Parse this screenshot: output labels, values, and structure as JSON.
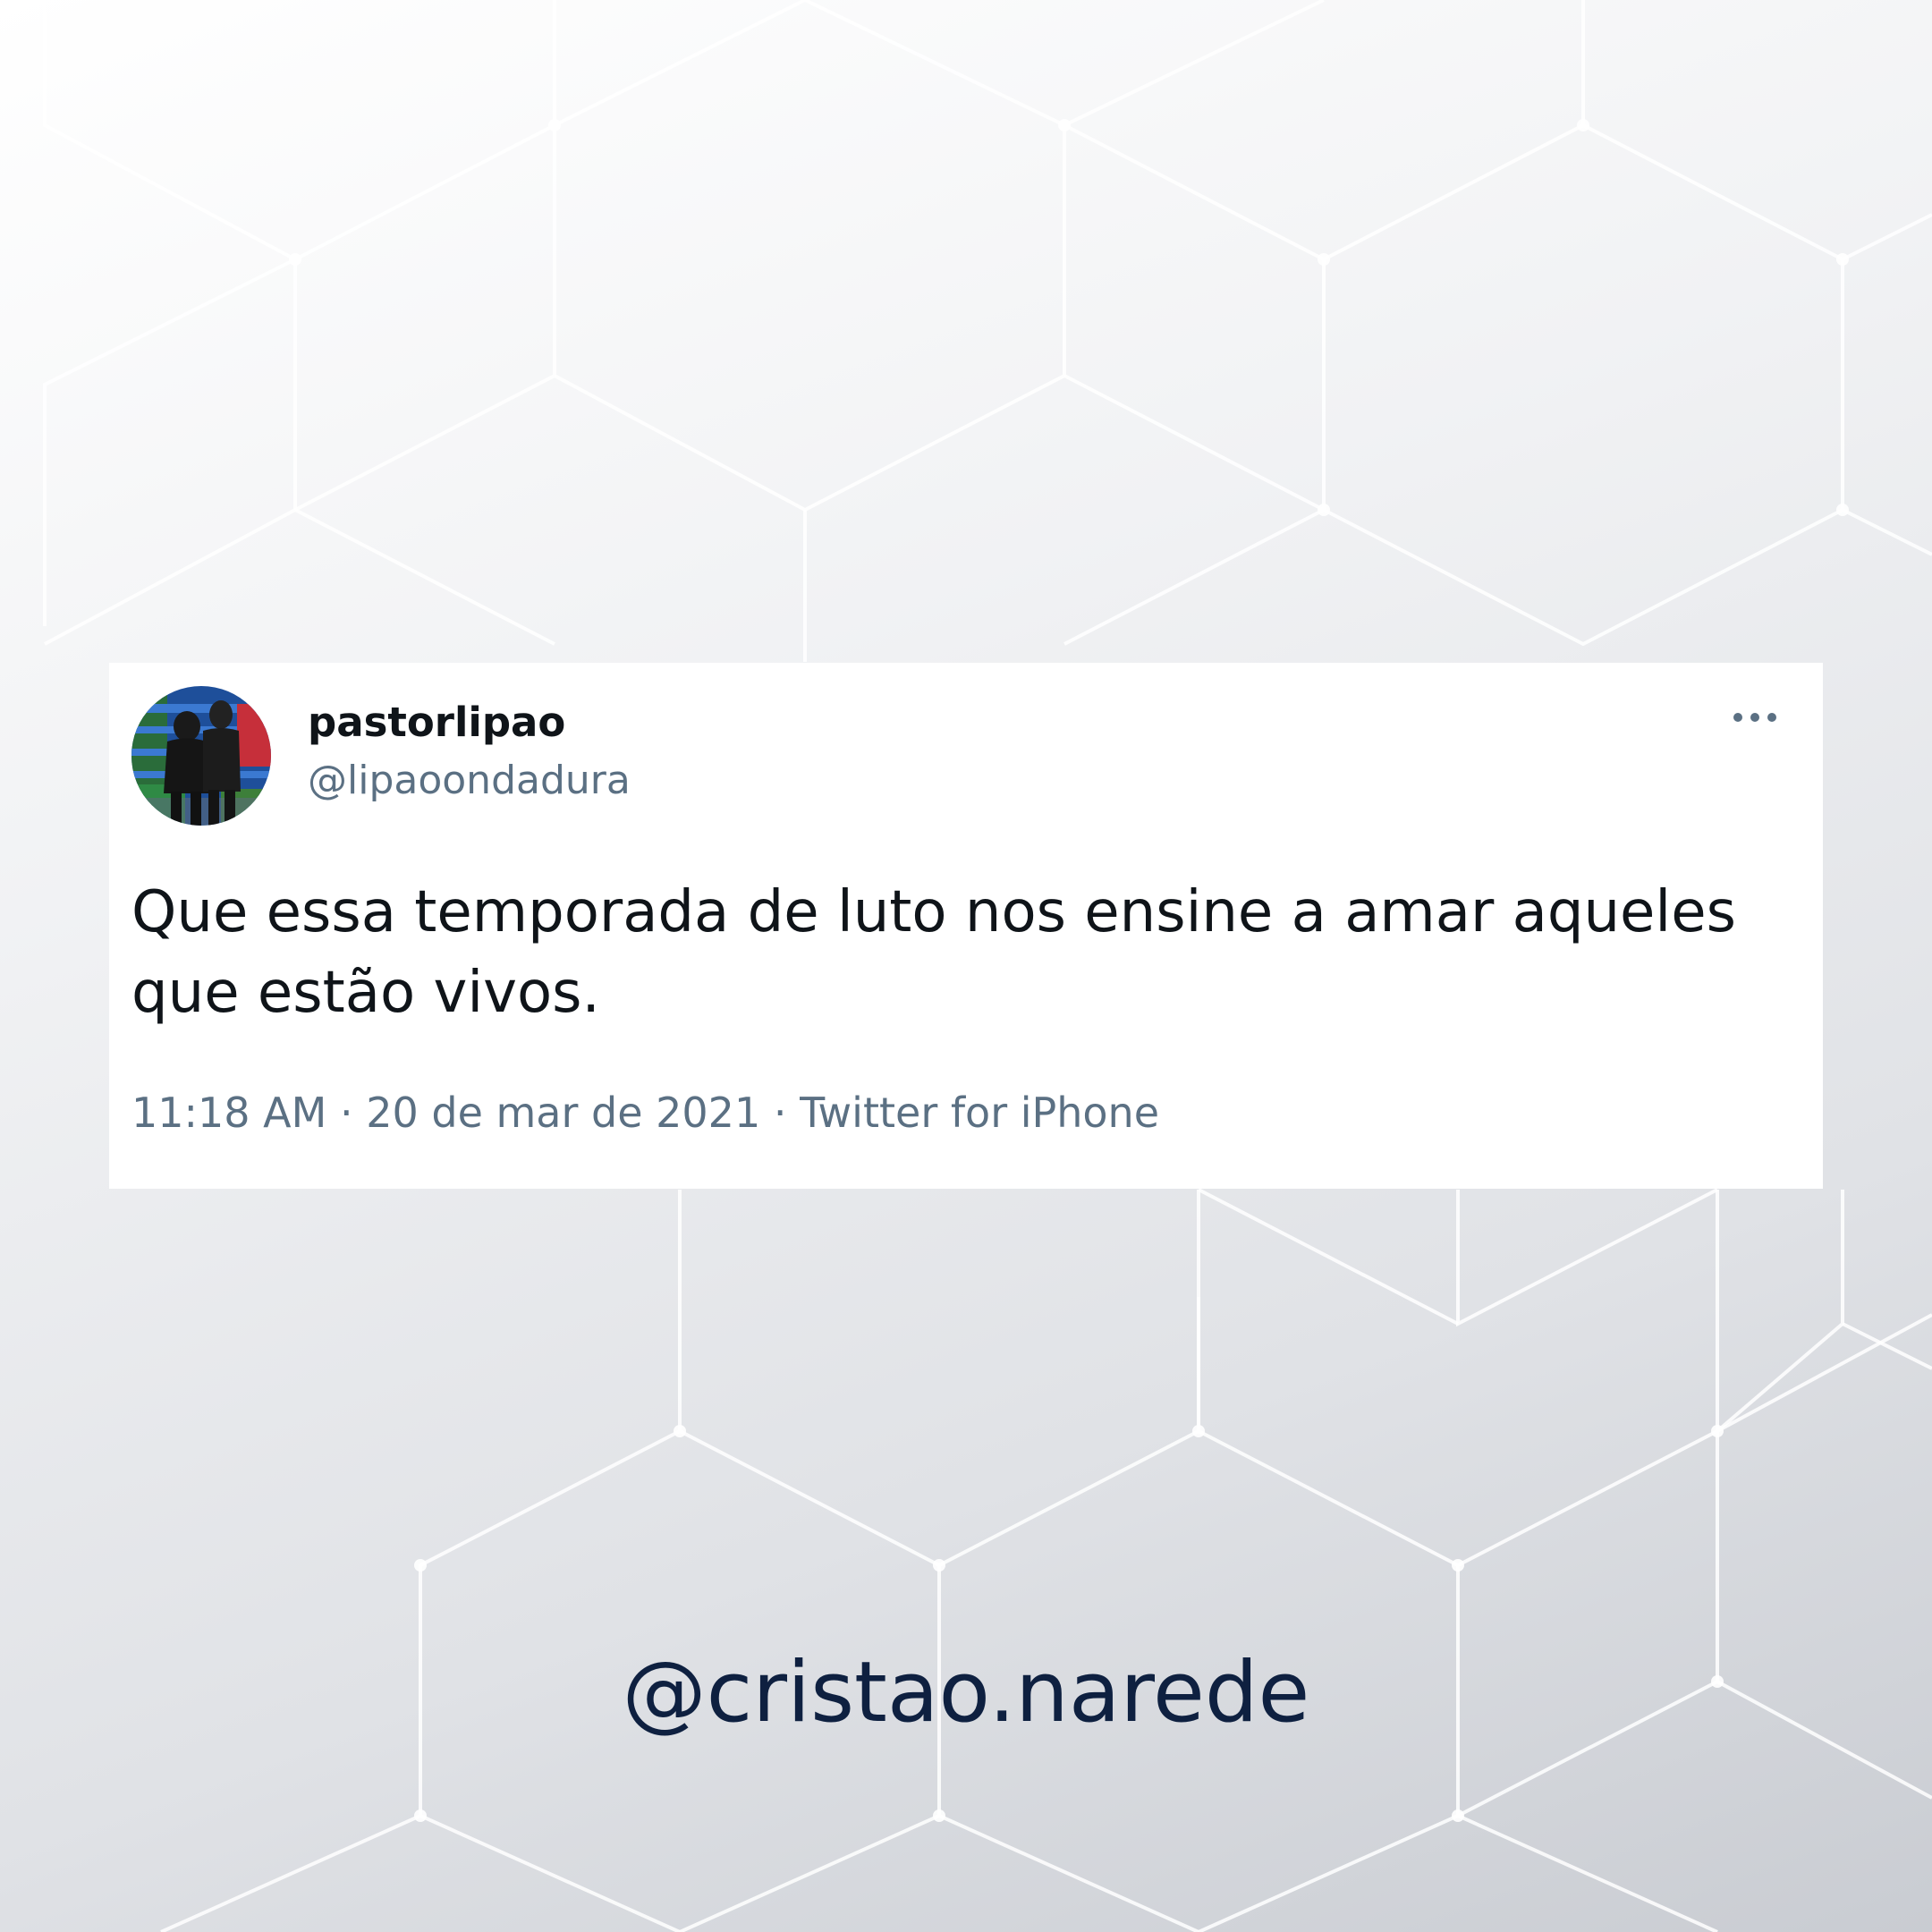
{
  "tweet": {
    "display_name": "pastorlipao",
    "handle": "@lipaoondadura",
    "text_line1": "Que essa temporada de luto nos ensine a amar aqueles",
    "text_line2": "que estão vivos.",
    "timestamp": "11:18 AM · 20 de mar de 2021 · Twitter for iPhone",
    "more_icon": "more-horizontal-icon"
  },
  "footer": {
    "handle": "@cristao.narede"
  },
  "colors": {
    "card_background": "#ffffff",
    "text_primary": "#0f1419",
    "text_secondary": "#5b7083",
    "watermark": "#0e2040"
  }
}
